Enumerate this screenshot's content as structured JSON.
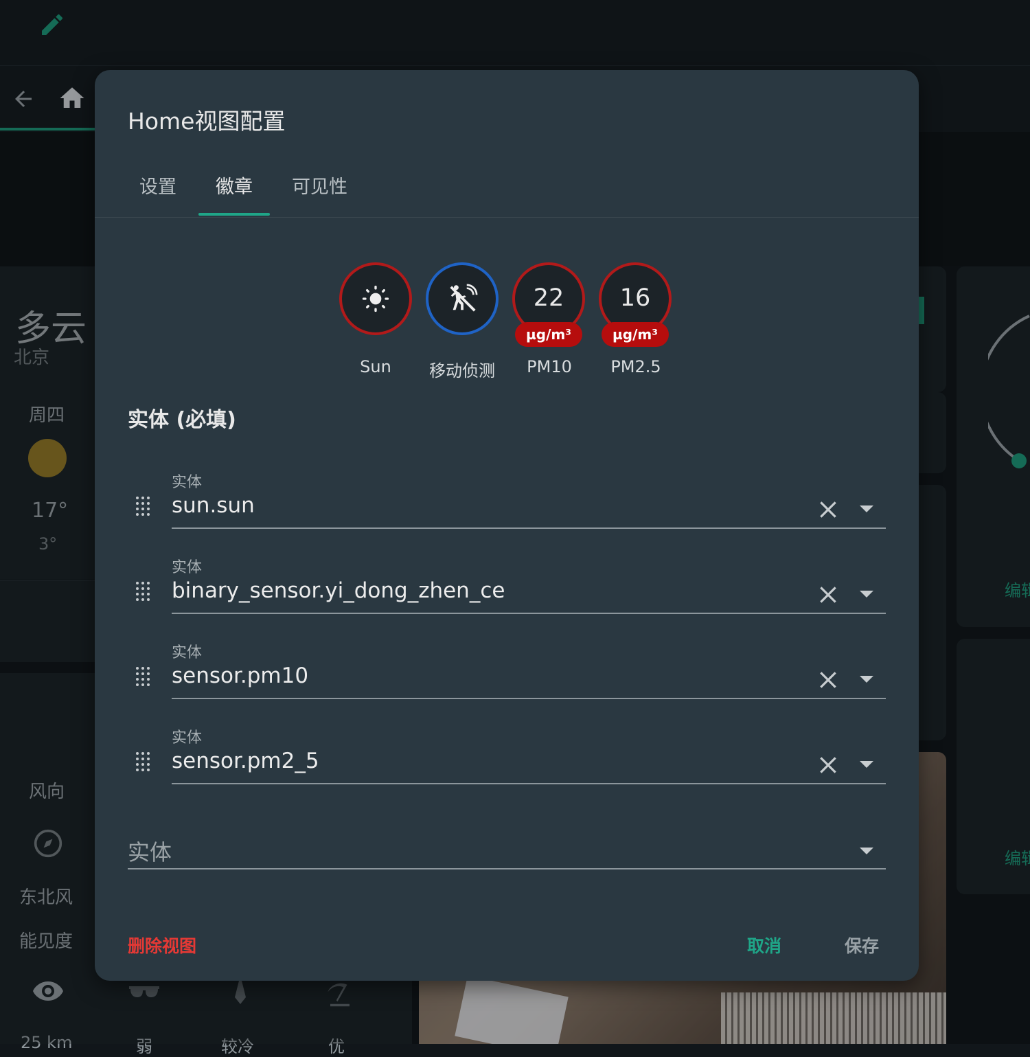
{
  "background": {
    "weather": {
      "condition": "多云",
      "city": "北京",
      "day": "周四",
      "high": "17°",
      "low": "3°",
      "wind_dir_label": "风向",
      "wind_dir_value": "东北风",
      "visibility_label": "能见度",
      "bottom_values": [
        "25 km",
        "弱",
        "较冷",
        "优"
      ]
    },
    "right_edit_label": "编辑"
  },
  "dialog": {
    "title": "Home视图配置",
    "tabs": [
      {
        "label": "设置"
      },
      {
        "label": "徽章",
        "active": true
      },
      {
        "label": "可见性"
      }
    ],
    "badges": [
      {
        "name": "Sun",
        "icon": "sun-icon",
        "ring_color": "#b21a1a"
      },
      {
        "name": "移动侦测",
        "icon": "motion-sensor-icon",
        "ring_color": "#1f63c6"
      },
      {
        "name": "PM10",
        "value": "22",
        "unit": "µg/m³",
        "ring_color": "#b21a1a"
      },
      {
        "name": "PM2.5",
        "value": "16",
        "unit": "µg/m³",
        "ring_color": "#b21a1a"
      }
    ],
    "entities_title": "实体 (必填)",
    "entities": [
      {
        "label": "实体",
        "value": "sun.sun"
      },
      {
        "label": "实体",
        "value": "binary_sensor.yi_dong_zhen_ce"
      },
      {
        "label": "实体",
        "value": "sensor.pm10"
      },
      {
        "label": "实体",
        "value": "sensor.pm2_5"
      }
    ],
    "new_entity_placeholder": "实体",
    "buttons": {
      "delete": "删除视图",
      "cancel": "取消",
      "save": "保存"
    }
  },
  "colors": {
    "accent": "#1fa688",
    "danger": "#e53935",
    "dialog_bg": "#2a3841"
  }
}
